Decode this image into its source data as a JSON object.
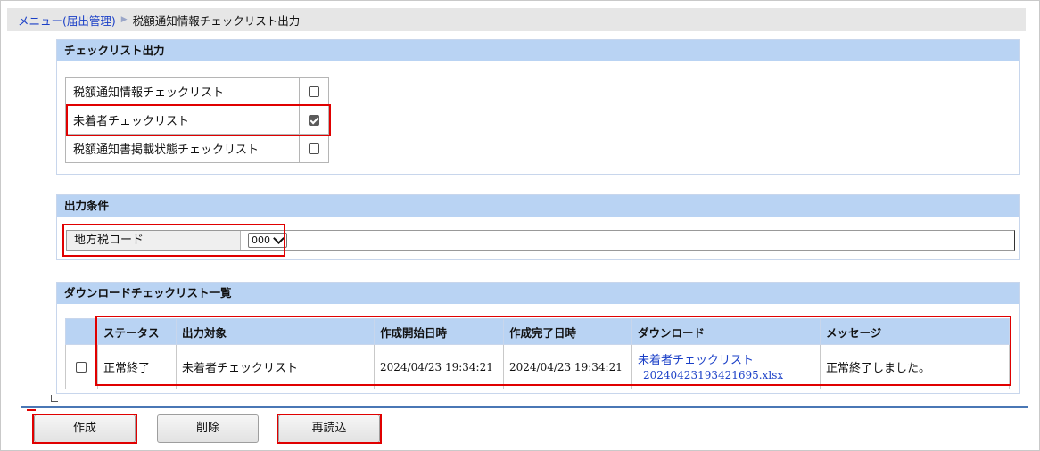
{
  "breadcrumb": {
    "menu_link": "メニュー(届出管理)",
    "current": "税額通知情報チェックリスト出力"
  },
  "checklist_output": {
    "title": "チェックリスト出力",
    "items": [
      {
        "label": "税額通知情報チェックリスト",
        "checked": false
      },
      {
        "label": "未着者チェックリスト",
        "checked": true
      },
      {
        "label": "税額通知書掲載状態チェックリスト",
        "checked": false
      }
    ]
  },
  "output_conditions": {
    "title": "出力条件",
    "local_tax_code_label": "地方税コード",
    "local_tax_code_value": "000"
  },
  "download_list": {
    "title": "ダウンロードチェックリスト一覧",
    "columns": [
      "ステータス",
      "出力対象",
      "作成開始日時",
      "作成完了日時",
      "ダウンロード",
      "メッセージ"
    ],
    "rows": [
      {
        "checked": false,
        "status": "正常終了",
        "target": "未着者チェックリスト",
        "start": "2024/04/23 19:34:21",
        "end": "2024/04/23 19:34:21",
        "download_line1": "未着者チェックリスト",
        "download_line2": "_20240423193421695.xlsx",
        "message": "正常終了しました。"
      }
    ]
  },
  "buttons": {
    "create": "作成",
    "delete": "削除",
    "reload": "再読込"
  },
  "colors": {
    "section_header": "#b9d3f3",
    "link": "#1a3fc7",
    "highlight": "#e00000"
  }
}
